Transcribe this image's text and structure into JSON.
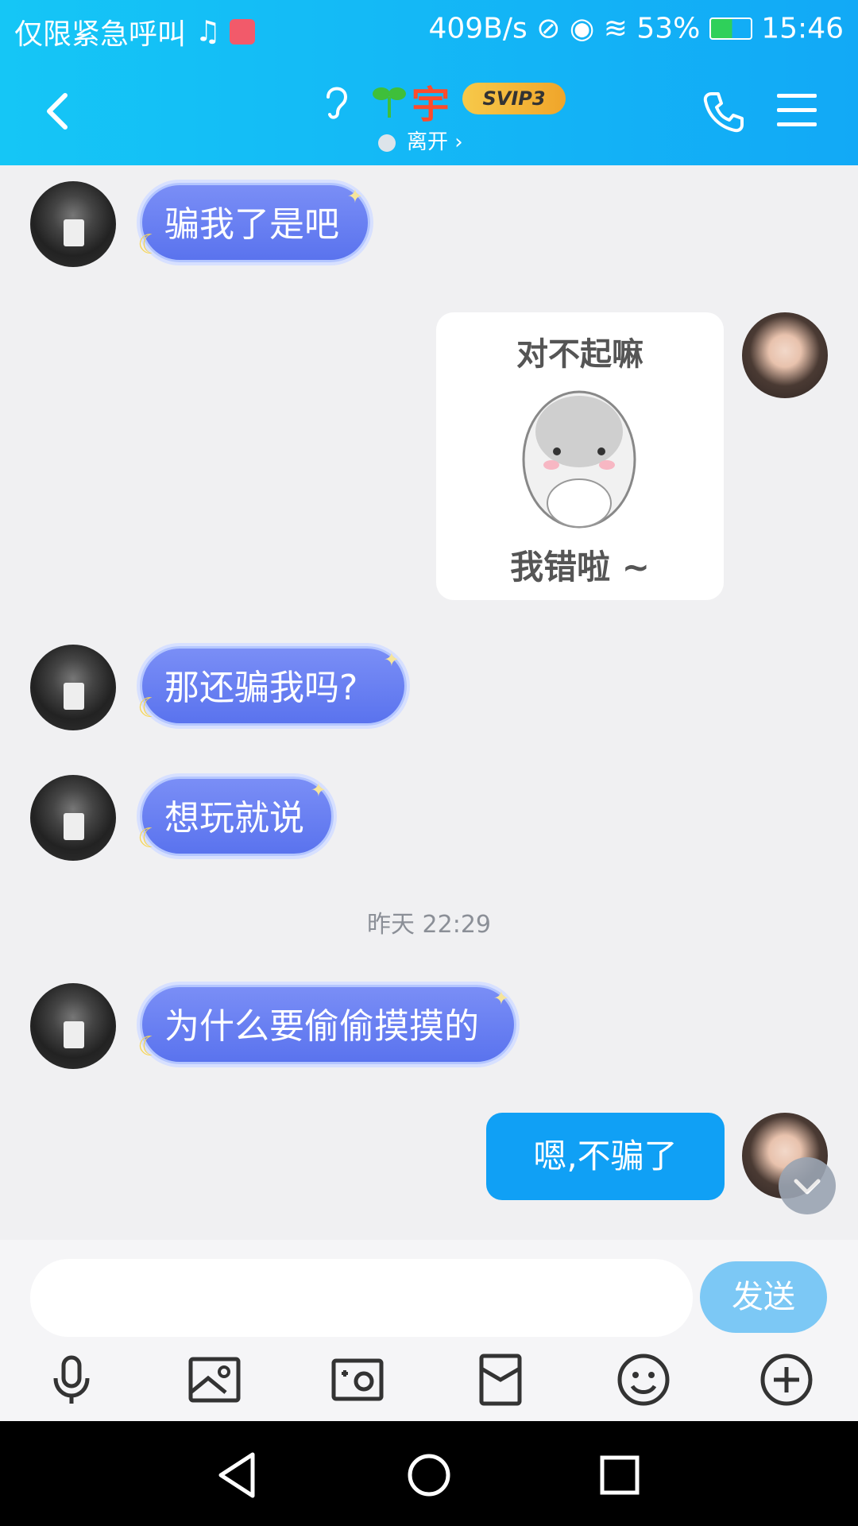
{
  "status_bar": {
    "carrier_text": "仅限紧急呼叫",
    "network_speed": "409B/s",
    "battery": "53%",
    "time": "15:46"
  },
  "header": {
    "contact_name": "宇",
    "badge": "SVIP3",
    "presence": "离开 ›"
  },
  "messages": [
    {
      "side": "left",
      "type": "text",
      "text": "骗我了是吧"
    },
    {
      "side": "right",
      "type": "sticker",
      "caption_top": "对不起嘛",
      "caption_bottom": "我错啦 ~"
    },
    {
      "side": "left",
      "type": "text",
      "text": "那还骗我吗?"
    },
    {
      "side": "left",
      "type": "text",
      "text": "想玩就说"
    },
    {
      "type": "timestamp",
      "text": "昨天 22:29"
    },
    {
      "side": "left",
      "type": "text",
      "text": "为什么要偷偷摸摸的"
    },
    {
      "side": "right",
      "type": "text",
      "text": "嗯,不骗了"
    }
  ],
  "composer": {
    "placeholder": "",
    "send_label": "发送"
  },
  "toolbar_icons": [
    "microphone-icon",
    "image-icon",
    "camera-icon",
    "red-packet-icon",
    "emoji-icon",
    "plus-icon"
  ],
  "nav_icons": [
    "back-triangle-icon",
    "home-circle-icon",
    "recents-square-icon"
  ],
  "colors": {
    "header": "#15b8f6",
    "bubble_self": "#10a0f5",
    "bubble_other": "#6b80f2",
    "send_button": "#7cc8f5"
  }
}
